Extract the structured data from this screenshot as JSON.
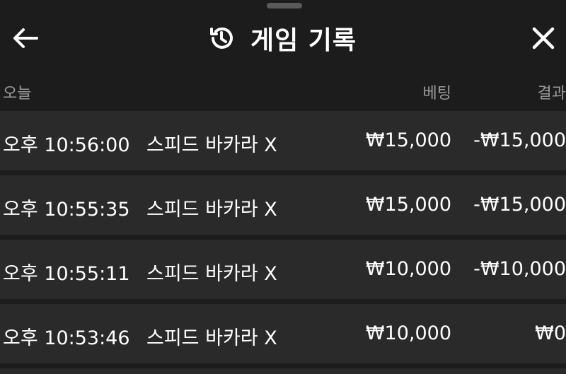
{
  "header": {
    "title": "게임 기록",
    "back_icon": "arrow-left-icon",
    "history_icon": "history-clock-icon",
    "close_icon": "close-x-icon"
  },
  "columns": {
    "date": "오늘",
    "bet": "베팅",
    "result": "결과"
  },
  "rows": [
    {
      "time": "오후 10:56:00",
      "game": "스피드 바카라 X",
      "bet": "₩15,000",
      "result": "-₩15,000"
    },
    {
      "time": "오후 10:55:35",
      "game": "스피드 바카라 X",
      "bet": "₩15,000",
      "result": "-₩15,000"
    },
    {
      "time": "오후 10:55:11",
      "game": "스피드 바카라 X",
      "bet": "₩10,000",
      "result": "-₩10,000"
    },
    {
      "time": "오후 10:53:46",
      "game": "스피드 바카라 X",
      "bet": "₩10,000",
      "result": "₩0"
    }
  ],
  "colors": {
    "background": "#1c1c1c",
    "row_background": "#2a2a2a",
    "text": "#ffffff",
    "muted_text": "#9a9a9a"
  }
}
